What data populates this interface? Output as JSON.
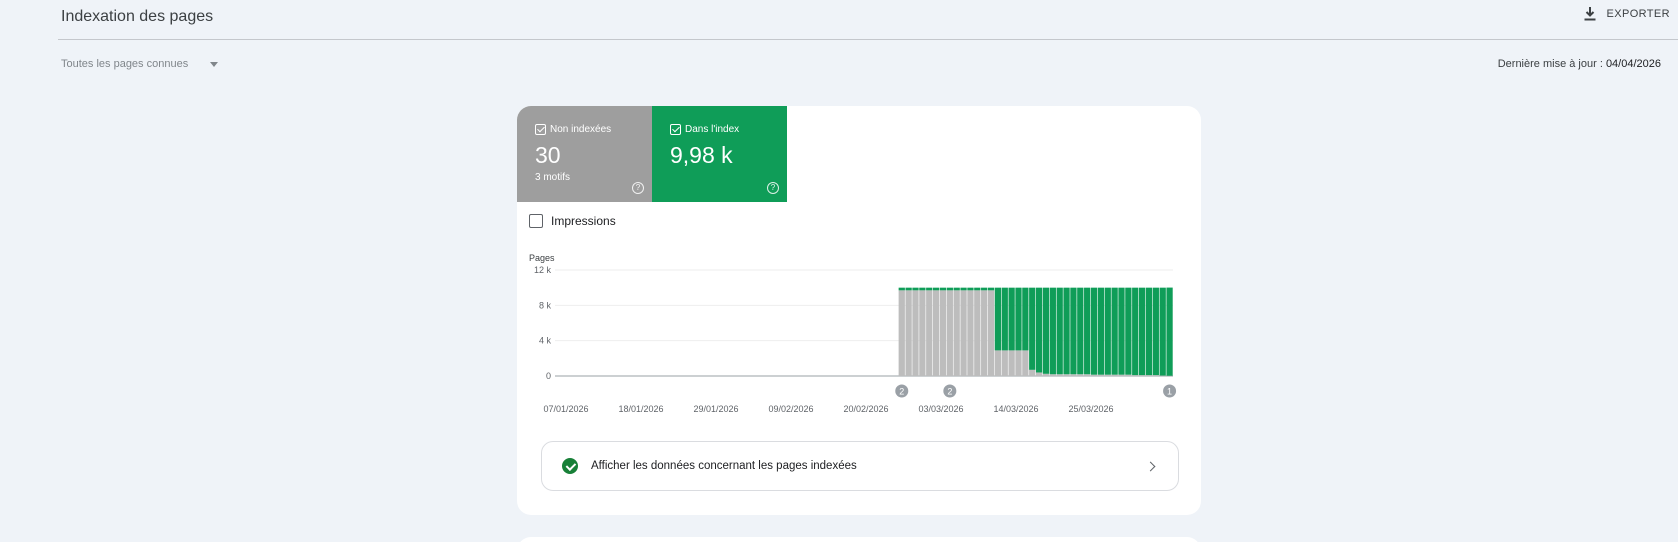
{
  "header": {
    "title": "Indexation des pages",
    "export_label": "EXPORTER",
    "filter_value": "Toutes les pages connues",
    "last_update_label": "Dernière mise à jour :",
    "last_update_date": "04/04/2026"
  },
  "tiles": [
    {
      "label": "Non indexées",
      "value": "30",
      "sub": "3 motifs",
      "color": "#9e9e9e"
    },
    {
      "label": "Dans l'index",
      "value": "9,98 k",
      "sub": "",
      "color": "#0f9d58"
    }
  ],
  "impressions_label": "Impressions",
  "indexed_link_label": "Afficher les données concernant les pages indexées",
  "chart_data": {
    "type": "bar",
    "stacked": true,
    "ylabel": "Pages",
    "yticks": [
      "12 k",
      "8 k",
      "4 k",
      "0"
    ],
    "ylim": [
      0,
      12000
    ],
    "xticks": [
      "07/01/2026",
      "18/01/2026",
      "29/01/2026",
      "09/02/2026",
      "20/02/2026",
      "03/03/2026",
      "14/03/2026",
      "25/03/2026"
    ],
    "series": [
      {
        "name": "Dans l'index",
        "color": "#0f9d58",
        "values": [
          0,
          0,
          0,
          0,
          0,
          0,
          0,
          0,
          0,
          0,
          0,
          0,
          0,
          0,
          0,
          0,
          0,
          0,
          0,
          0,
          0,
          0,
          0,
          0,
          0,
          0,
          0,
          0,
          0,
          0,
          0,
          0,
          0,
          0,
          0,
          0,
          0,
          0,
          0,
          0,
          0,
          0,
          0,
          0,
          0,
          0,
          0,
          0,
          0,
          0,
          300,
          300,
          300,
          300,
          300,
          300,
          300,
          300,
          300,
          300,
          300,
          300,
          300,
          300,
          7100,
          7100,
          7100,
          7100,
          7100,
          9300,
          9600,
          9750,
          9800,
          9800,
          9800,
          9800,
          9800,
          9800,
          9850,
          9850,
          9850,
          9850,
          9850,
          9850,
          9900,
          9900,
          9900,
          9900,
          9950,
          9980
        ]
      },
      {
        "name": "Non indexées",
        "color": "#bdbdbd",
        "values": [
          0,
          0,
          0,
          0,
          0,
          0,
          0,
          0,
          0,
          0,
          0,
          0,
          0,
          0,
          0,
          0,
          0,
          0,
          0,
          0,
          0,
          0,
          0,
          0,
          0,
          0,
          0,
          0,
          0,
          0,
          0,
          0,
          0,
          0,
          0,
          0,
          0,
          0,
          0,
          0,
          0,
          0,
          0,
          0,
          0,
          0,
          0,
          0,
          0,
          0,
          9700,
          9700,
          9700,
          9700,
          9700,
          9700,
          9700,
          9700,
          9700,
          9700,
          9700,
          9700,
          9700,
          9700,
          2900,
          2900,
          2900,
          2900,
          2900,
          700,
          400,
          250,
          200,
          200,
          200,
          200,
          200,
          200,
          150,
          150,
          150,
          150,
          150,
          150,
          100,
          100,
          100,
          100,
          50,
          30
        ]
      }
    ],
    "annotations": [
      {
        "label": "2",
        "index": 50
      },
      {
        "label": "2",
        "index": 57
      },
      {
        "label": "1",
        "index": 89
      }
    ]
  }
}
